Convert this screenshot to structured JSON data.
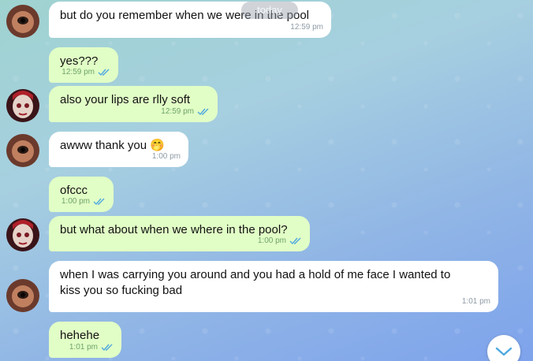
{
  "date_pill": "today",
  "messages": [
    {
      "text": "but do you remember when we were in the pool",
      "time": "12:59 pm"
    },
    {
      "text": "yes???",
      "time": "12:59 pm"
    },
    {
      "text": "also your lips are rlly soft",
      "time": "12:59 pm"
    },
    {
      "text": "awww thank you 🤭",
      "time": "1:00 pm"
    },
    {
      "text": "ofccc",
      "time": "1:00 pm"
    },
    {
      "text": "but what about when we where in the pool?",
      "time": "1:00 pm"
    },
    {
      "text": "when I was carrying you around and you had a hold of me face I wanted to kiss you so fucking bad",
      "time": "1:01 pm"
    },
    {
      "text": "hehehe",
      "time": "1:01 pm"
    }
  ],
  "icons": {
    "read_receipt": "double-check-icon",
    "scroll_down": "chevron-down-icon"
  },
  "colors": {
    "incoming_bubble": "#ffffff",
    "outgoing_bubble": "#e1fec6",
    "accent": "#4fa8e0"
  }
}
